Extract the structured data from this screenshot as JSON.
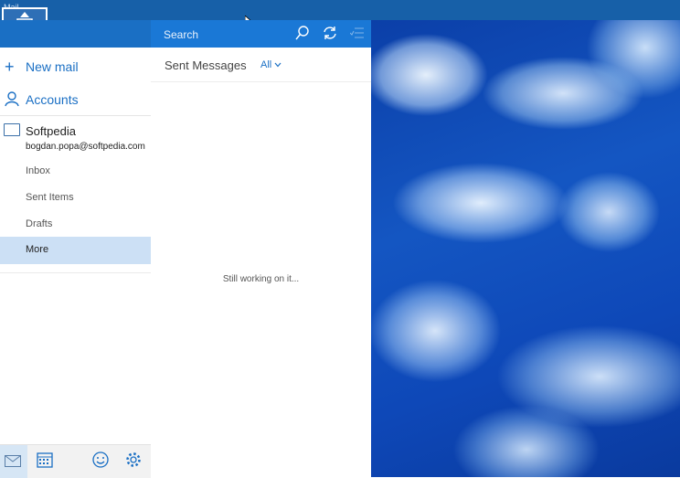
{
  "window": {
    "title": "Mail"
  },
  "nav": {
    "new_mail": "New mail",
    "accounts": "Accounts"
  },
  "account": {
    "name": "Softpedia",
    "email": "bogdan.popa@softpedia.com"
  },
  "folders": [
    "Inbox",
    "Sent Items",
    "Drafts",
    "More"
  ],
  "selected_folder": "More",
  "search": {
    "placeholder": "Search"
  },
  "message_list": {
    "header": "Sent Messages",
    "filter": "All",
    "status": "Still working on it..."
  },
  "colors": {
    "accent": "#1a6fc4",
    "titlebar": "#1760a8",
    "selected": "#cce0f5"
  }
}
